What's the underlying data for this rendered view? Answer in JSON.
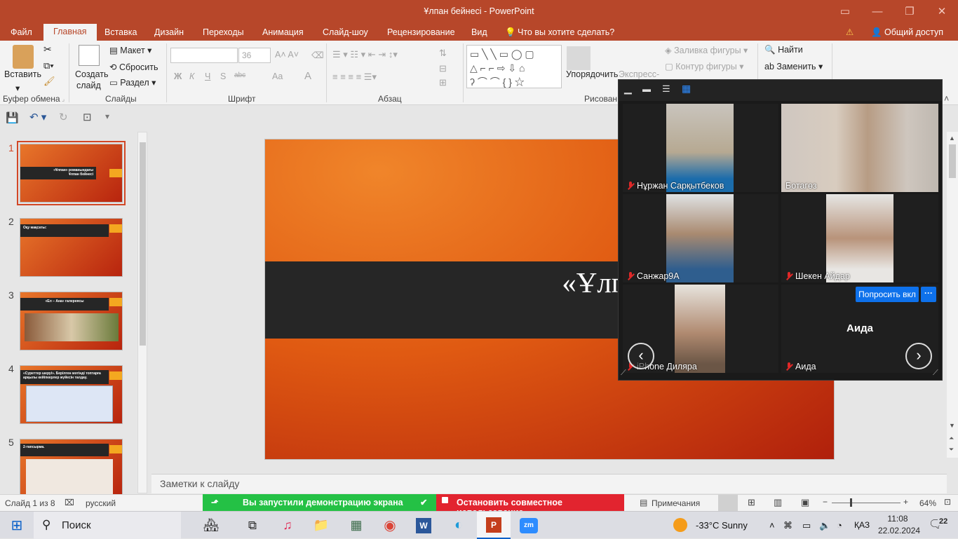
{
  "window": {
    "title": "Ұлпан бейнесі - PowerPoint"
  },
  "menu": {
    "file": "Файл",
    "home": "Главная",
    "insert": "Вставка",
    "design": "Дизайн",
    "transitions": "Переходы",
    "animation": "Анимация",
    "slideshow": "Слайд-шоу",
    "review": "Рецензирование",
    "view": "Вид",
    "tell_me": "Что вы хотите сделать?",
    "share": "Общий доступ"
  },
  "ribbon": {
    "clipboard": {
      "label": "Буфер обмена",
      "paste": "Вставить"
    },
    "slides": {
      "label": "Слайды",
      "new_slide_1": "Создать",
      "new_slide_2": "слайд",
      "layout": "Макет",
      "reset": "Сбросить",
      "section": "Раздел"
    },
    "font": {
      "label": "Шрифт",
      "font_name": "",
      "font_size": "36",
      "bold": "Ж",
      "italic": "К",
      "underline": "Ч",
      "shadow": "S",
      "strike": "abc",
      "case": "Aa",
      "color": "A"
    },
    "paragraph": {
      "label": "Абзац"
    },
    "drawing": {
      "label": "Рисован",
      "arrange": "Упорядочить",
      "express": "Экспресс-",
      "fill": "Заливка фигуры",
      "outline": "Контур фигуры"
    },
    "editing": {
      "find": "Найти",
      "replace": "Заменить"
    }
  },
  "thumbnails": [
    {
      "num": "1",
      "title_l1": "«Ұлпан» романындағы",
      "title_l2": "Ұлпан бейнесі"
    },
    {
      "num": "2",
      "title_l1": "Оқу мақсаты:",
      "title_l2": ""
    },
    {
      "num": "3",
      "title_l1": "«Ел – Ана» галереясы",
      "title_l2": ""
    },
    {
      "num": "4",
      "title_l1": "«Суреттер шеруі». Берілген мәтінді топтарға",
      "title_l2": "арқылы кейіпкерлер жүйесін талдау."
    },
    {
      "num": "5",
      "title_l1": "2-тапсырма.",
      "title_l2": ""
    }
  ],
  "slide": {
    "title_l1": "«Ұлпан» романынд",
    "title_l2": "Ұлпан бей"
  },
  "notes": {
    "placeholder": "Заметки к слайду"
  },
  "zoom": {
    "participants": [
      {
        "name": "Нұржан Сарқытбеков"
      },
      {
        "name": "Ботагөз"
      },
      {
        "name": "Санжар9А"
      },
      {
        "name": "Шекен Айдар"
      },
      {
        "name": "iPhone Диляра"
      },
      {
        "name": "Аида",
        "center_name": "Аида"
      }
    ],
    "ask_unmute": "Попросить вкл",
    "more": "···"
  },
  "status": {
    "slide_info": "Слайд 1 из 8",
    "language": "русский",
    "sharing": "Вы запустили демонстрацию экрана",
    "stop_sharing": "Остановить совместное использование",
    "comments": "Примечания",
    "zoom_level": "64%"
  },
  "taskbar": {
    "search": "Поиск",
    "weather": "-33°C  Sunny",
    "lang": "ҚАЗ",
    "time": "11:08",
    "date": "22.02.2024",
    "notifications": "22"
  }
}
